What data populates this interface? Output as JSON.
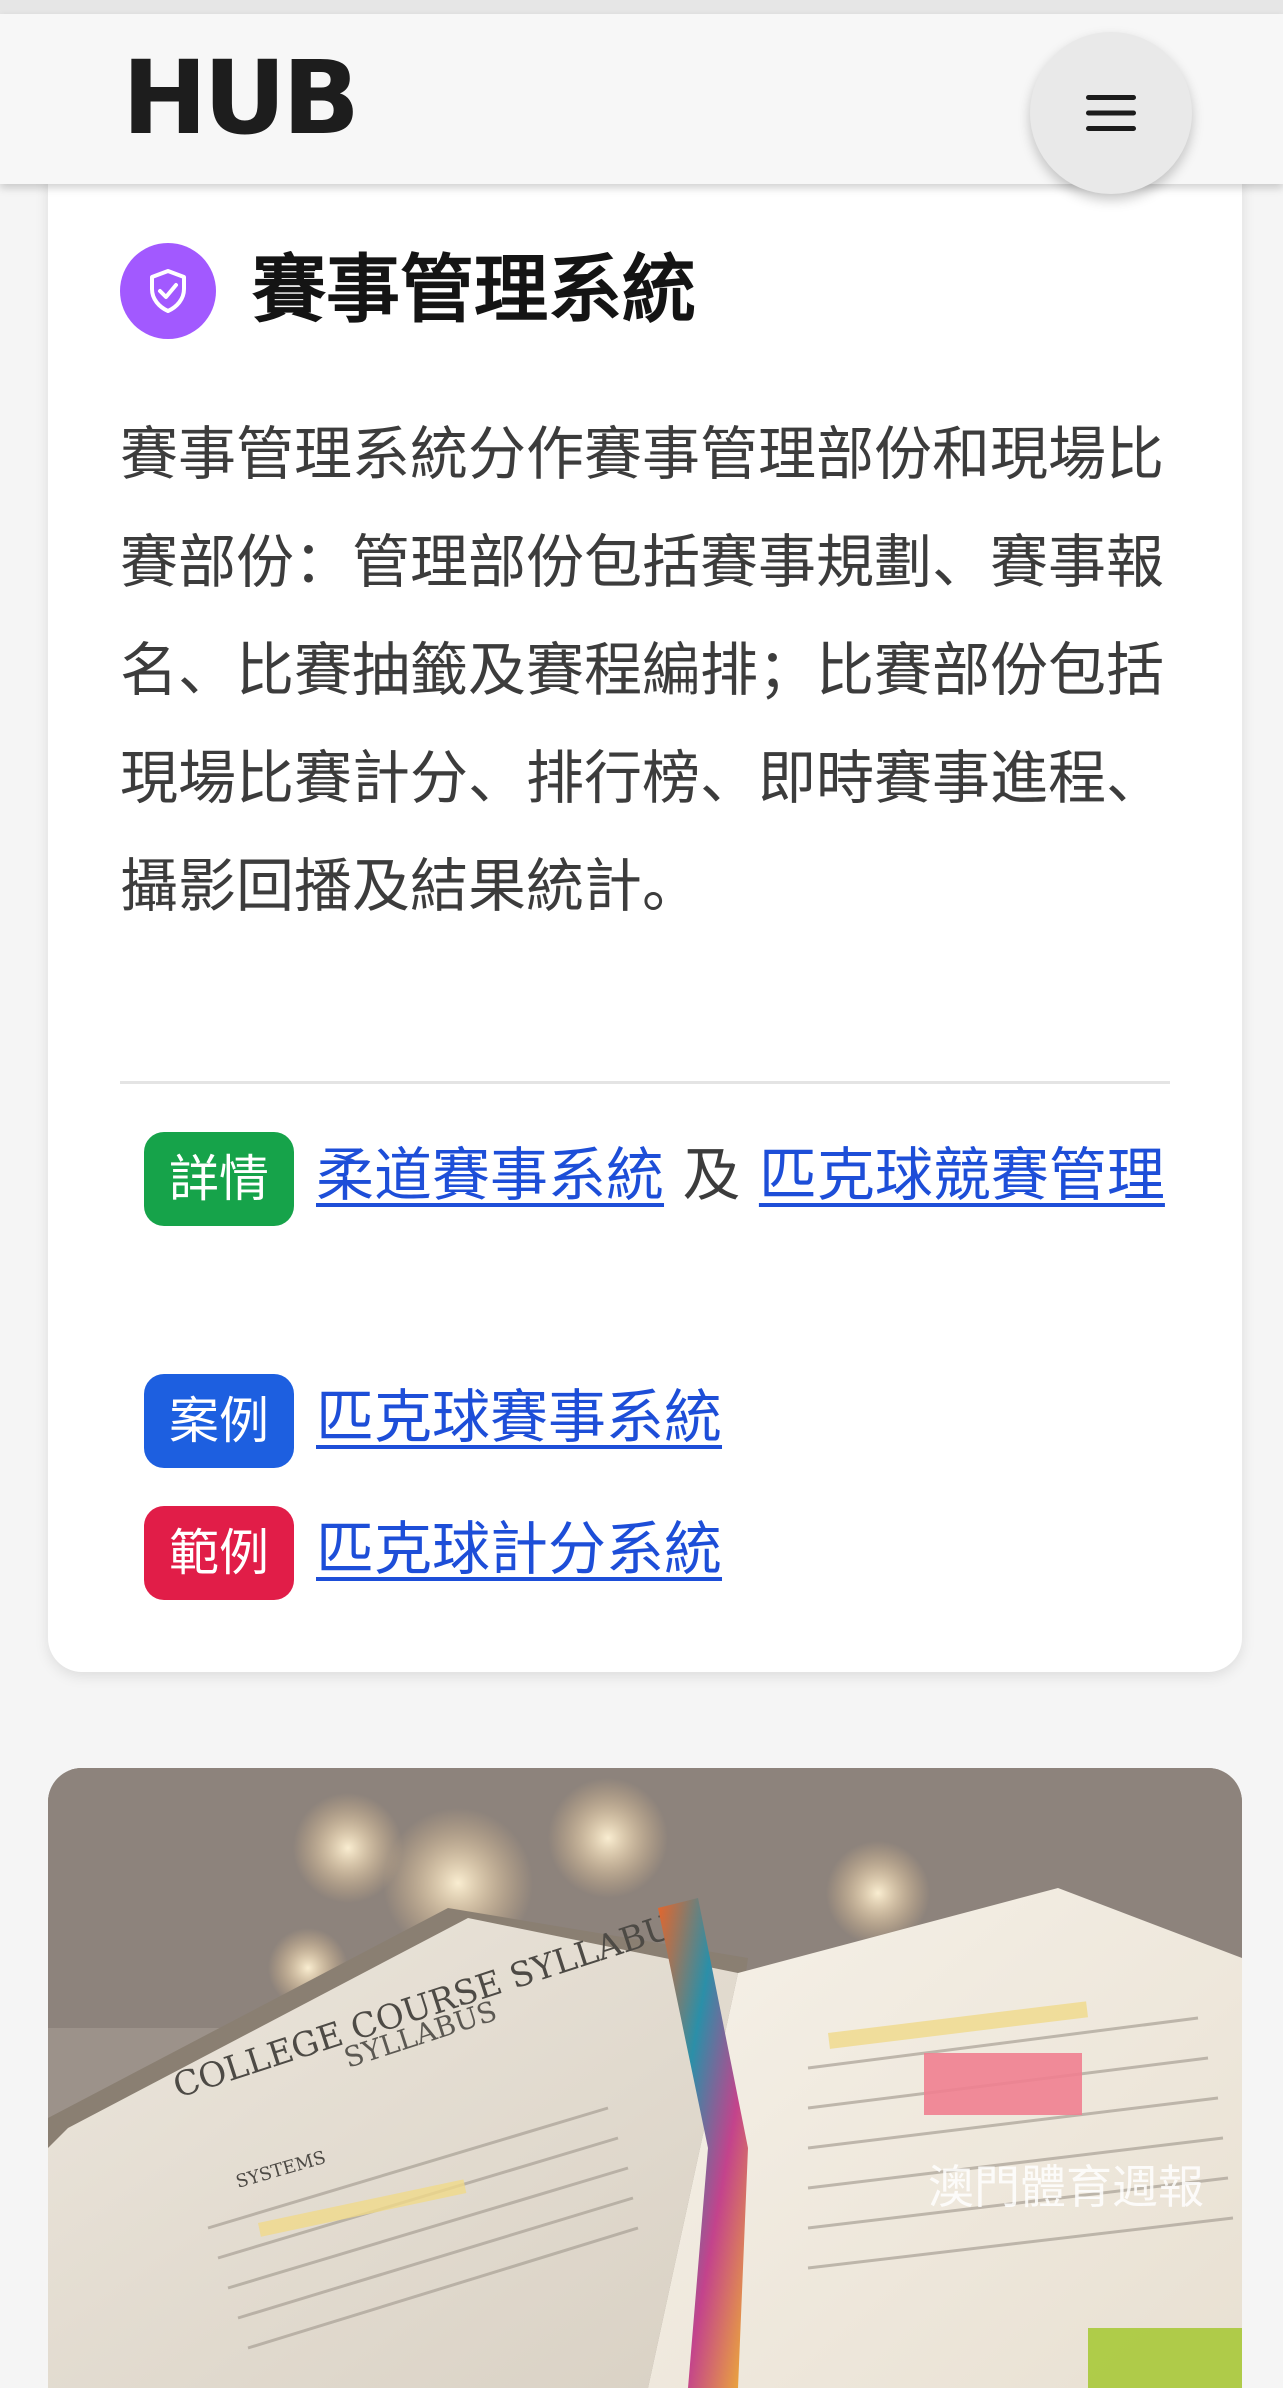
{
  "header": {
    "logo_text": "HUB",
    "menu_icon": "hamburger-menu-icon"
  },
  "card": {
    "icon": "shield-check-icon",
    "title": "賽事管理系統",
    "description": "賽事管理系統分作賽事管理部份和現場比賽部份：管理部份包括賽事規劃、賽事報名、比賽抽籤及賽程編排；比賽部份包括現場比賽計分、排行榜、即時賽事進程、攝影回播及結果統計。",
    "details": {
      "tag": "詳情",
      "link1": "柔道賽事系統",
      "joiner": "及",
      "link2": "匹克球競賽管理"
    },
    "case": {
      "tag": "案例",
      "link": "匹克球賽事系統"
    },
    "example": {
      "tag": "範例",
      "link": "匹克球計分系統"
    }
  },
  "image": {
    "book_heading": "COLLEGE COURSE SYLLABUS",
    "book_subheading": "SYLLABUS",
    "book_section": "SYSTEMS",
    "watermark": "澳門體育週報"
  },
  "colors": {
    "accent_purple": "#a259ff",
    "tag_green": "#16a34a",
    "tag_blue": "#1d5fe0",
    "tag_red": "#e11d48",
    "link_blue": "#1d4ed8"
  }
}
